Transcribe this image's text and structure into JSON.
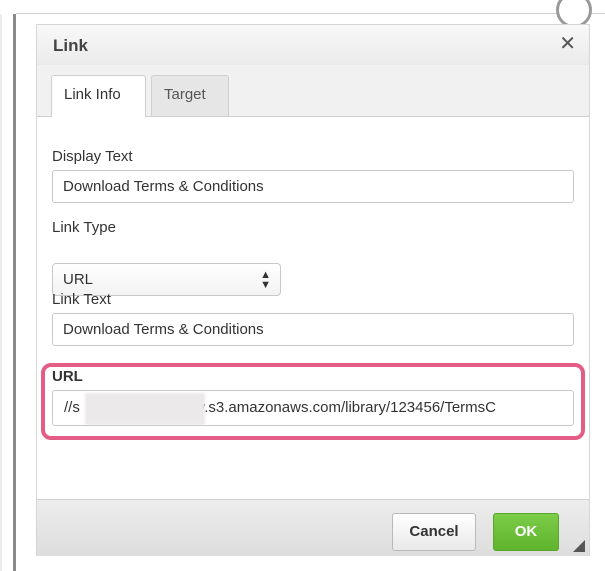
{
  "dialog": {
    "title": "Link",
    "close_glyph": "✕"
  },
  "tabs": [
    {
      "label": "Link Info"
    },
    {
      "label": "Target"
    }
  ],
  "fields": {
    "display_text": {
      "label": "Display Text",
      "value": "Download Terms & Conditions"
    },
    "link_type": {
      "label": "Link Type",
      "value": "URL"
    },
    "link_text": {
      "label": "Link Text",
      "value": "Download Terms & Conditions"
    },
    "url": {
      "label": "URL",
      "value_prefix": "//s",
      "value_suffix": "ry.s3.amazonaws.com/library/123456/TermsC"
    }
  },
  "footer": {
    "cancel_label": "Cancel",
    "ok_label": "OK"
  },
  "colors": {
    "highlight": "#e35d86",
    "ok_button": "#6abf36"
  },
  "icons": {
    "close": "close-icon",
    "select_arrows": "updown-arrows-icon",
    "resize": "resize-grip-icon"
  }
}
